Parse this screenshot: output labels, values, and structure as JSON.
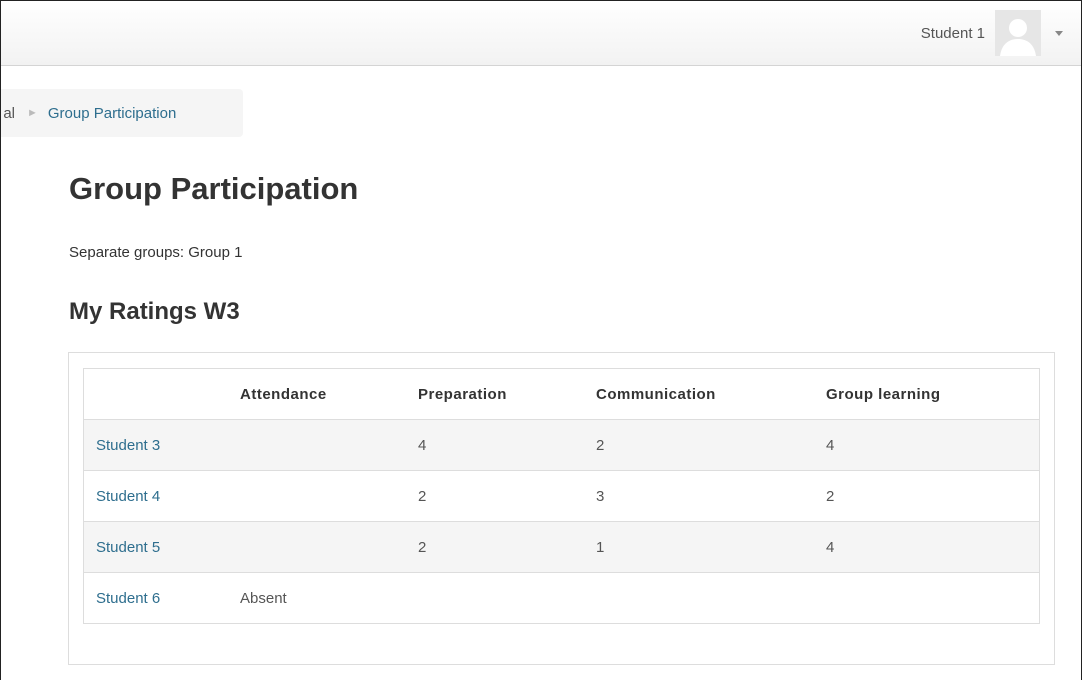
{
  "header": {
    "user_name": "Student 1"
  },
  "breadcrumb": {
    "previous_partial": "al",
    "separator": "►",
    "current": "Group Participation"
  },
  "main": {
    "title": "Group Participation",
    "groups_label": "Separate groups: Group 1",
    "section_title": "My Ratings W3"
  },
  "table": {
    "columns": [
      "",
      "Attendance",
      "Preparation",
      "Communication",
      "Group learning"
    ],
    "rows": [
      {
        "student": "Student 3",
        "attendance": "",
        "preparation": "4",
        "communication": "2",
        "group_learning": "4"
      },
      {
        "student": "Student 4",
        "attendance": "",
        "preparation": "2",
        "communication": "3",
        "group_learning": "2"
      },
      {
        "student": "Student 5",
        "attendance": "",
        "preparation": "2",
        "communication": "1",
        "group_learning": "4"
      },
      {
        "student": "Student 6",
        "attendance": "Absent",
        "preparation": "",
        "communication": "",
        "group_learning": ""
      }
    ]
  },
  "colors": {
    "link": "#2e6e8e",
    "stripe": "#f5f5f5",
    "border": "#dddddd"
  },
  "icons": {
    "avatar": "default-user-avatar-icon",
    "menu": "caret-down-icon",
    "separator": "triangle-right-icon"
  }
}
